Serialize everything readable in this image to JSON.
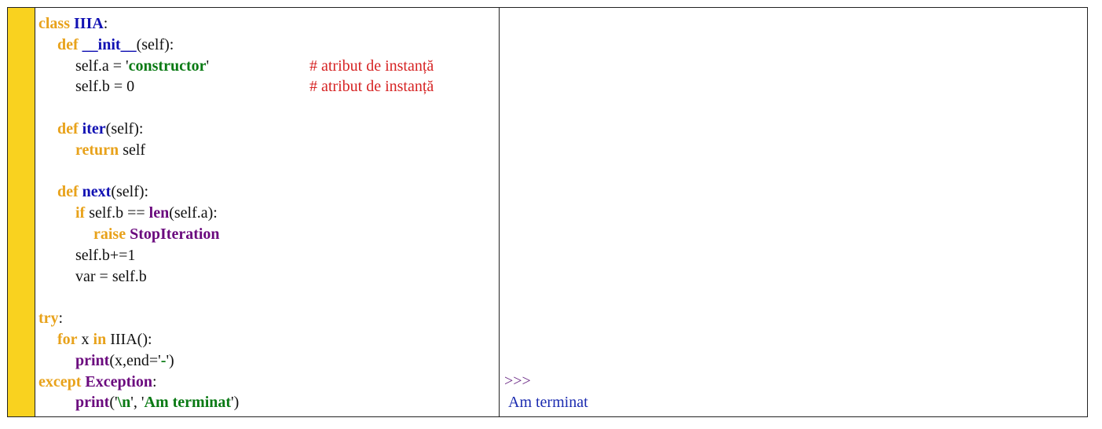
{
  "colors": {
    "stripe": "#f9d21f",
    "keyword": "#e8a21b",
    "name": "#1111b3",
    "builtin": "#6b0a7e",
    "string": "#0a7a14",
    "comment": "#d62424",
    "output": "#1b2bb0",
    "prompt": "#6b2a86"
  },
  "code": {
    "l1": {
      "kw": "class",
      "name": "IIIA",
      "tail": ":"
    },
    "l2": {
      "kw": "def",
      "name": "__init__",
      "tail": "(self):"
    },
    "l3": {
      "pre": "self.a = '",
      "str": "constructor",
      "post": "'",
      "comment": "# atribut de instanță"
    },
    "l4": {
      "text": "self.b = 0",
      "comment": "# atribut de instanță"
    },
    "l6": {
      "kw": "def",
      "name": "iter",
      "tail": "(self):"
    },
    "l7": {
      "kw": "return",
      "tail": " self"
    },
    "l9": {
      "kw": "def",
      "name": "next",
      "tail": "(self):"
    },
    "l10": {
      "kw": "if",
      "mid": " self.b == ",
      "fn": "len",
      "tail": "(self.a):"
    },
    "l11": {
      "kw": "raise",
      "fn": "StopIteration"
    },
    "l12": {
      "text": "self.b+=1"
    },
    "l13": {
      "text": "var = self.b"
    },
    "l15": {
      "kw": "try",
      "tail": ":"
    },
    "l16": {
      "kw": "for",
      "mid": " x ",
      "kw2": "in",
      "tail": " IIIA():"
    },
    "l17": {
      "fn": "print",
      "pre": "(x,end='",
      "str": "-",
      "post": "')"
    },
    "l18": {
      "kw": "except",
      "fn": "Exception",
      "tail": ":"
    },
    "l19": {
      "fn": "print",
      "pre": "('",
      "str1": "\\n",
      "mid": "', '",
      "str2": "Am terminat",
      "post": "')"
    }
  },
  "output": {
    "prompt": ">>>",
    "result": "Am terminat"
  }
}
